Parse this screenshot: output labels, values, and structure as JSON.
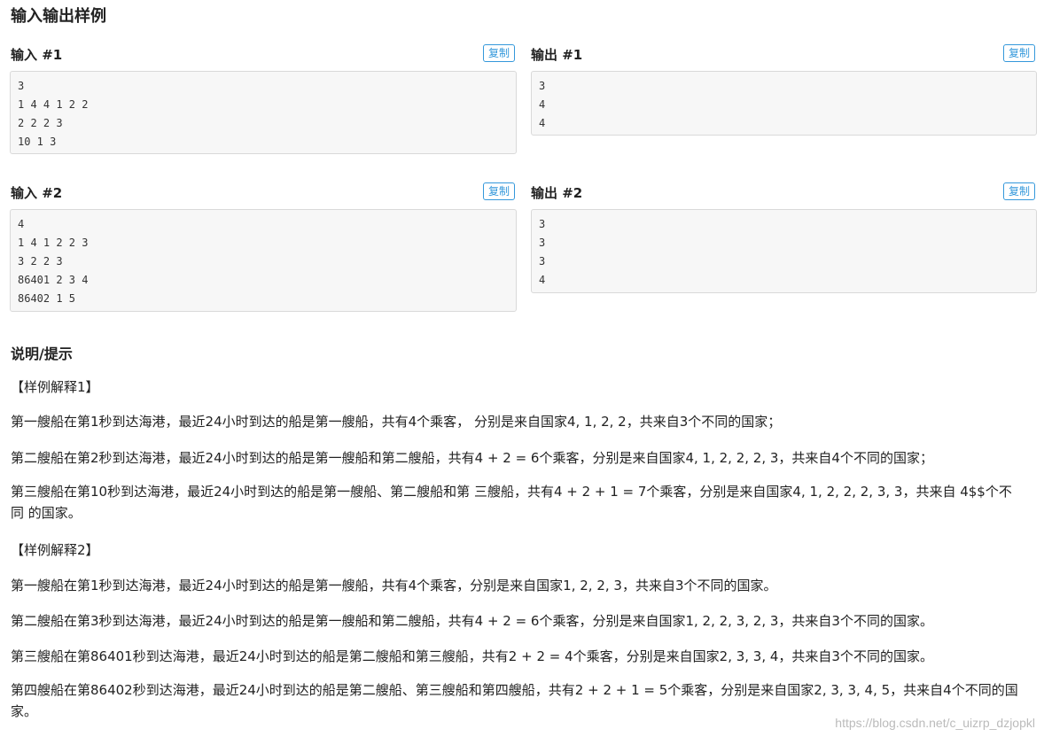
{
  "section_title": "输入输出样例",
  "copy_label": "复制",
  "samples": [
    {
      "input_label": "输入 #1",
      "output_label": "输出 #1",
      "input": "3\n1 4 4 1 2 2\n2 2 2 3\n10 1 3",
      "output": "3\n4\n4"
    },
    {
      "input_label": "输入 #2",
      "output_label": "输出 #2",
      "input": "4\n1 4 1 2 2 3\n3 2 2 3\n86401 2 3 4\n86402 1 5",
      "output": "3\n3\n3\n4"
    }
  ],
  "hint": {
    "title": "说明/提示",
    "explain1_title": "【样例解释1】",
    "explain1": [
      "第一艘船在第1秒到达海港，最近24小时到达的船是第一艘船，共有4个乘客， 分别是来自国家4, 1, 2, 2，共来自3个不同的国家；",
      "第二艘船在第2秒到达海港，最近24小时到达的船是第一艘船和第二艘船，共有4 + 2 = 6个乘客，分别是来自国家4, 1, 2, 2, 2, 3，共来自4个不同的国家；",
      "第三艘船在第10秒到达海港，最近24小时到达的船是第一艘船、第二艘船和第 三艘船，共有4 + 2 + 1 = 7个乘客，分别是来自国家4, 1, 2, 2, 2, 3, 3，共来自 4$$个不同 的国家。"
    ],
    "explain2_title": "【样例解释2】",
    "explain2": [
      "第一艘船在第1秒到达海港，最近24小时到达的船是第一艘船，共有4个乘客，分别是来自国家1, 2, 2, 3，共来自3个不同的国家。",
      "第二艘船在第3秒到达海港，最近24小时到达的船是第一艘船和第二艘船，共有4 + 2 = 6个乘客，分别是来自国家1, 2, 2, 3, 2, 3，共来自3个不同的国家。",
      "第三艘船在第86401秒到达海港，最近24小时到达的船是第二艘船和第三艘船，共有2 + 2 = 4个乘客，分别是来自国家2, 3, 3, 4，共来自3个不同的国家。",
      "第四艘船在第86402秒到达海港，最近24小时到达的船是第二艘船、第三艘船和第四艘船，共有2 + 2 + 1 = 5个乘客，分别是来自国家2, 3, 3, 4, 5，共来自4个不同的国家。"
    ]
  },
  "watermark": "https://blog.csdn.net/c_uizrp_dzjopkl"
}
